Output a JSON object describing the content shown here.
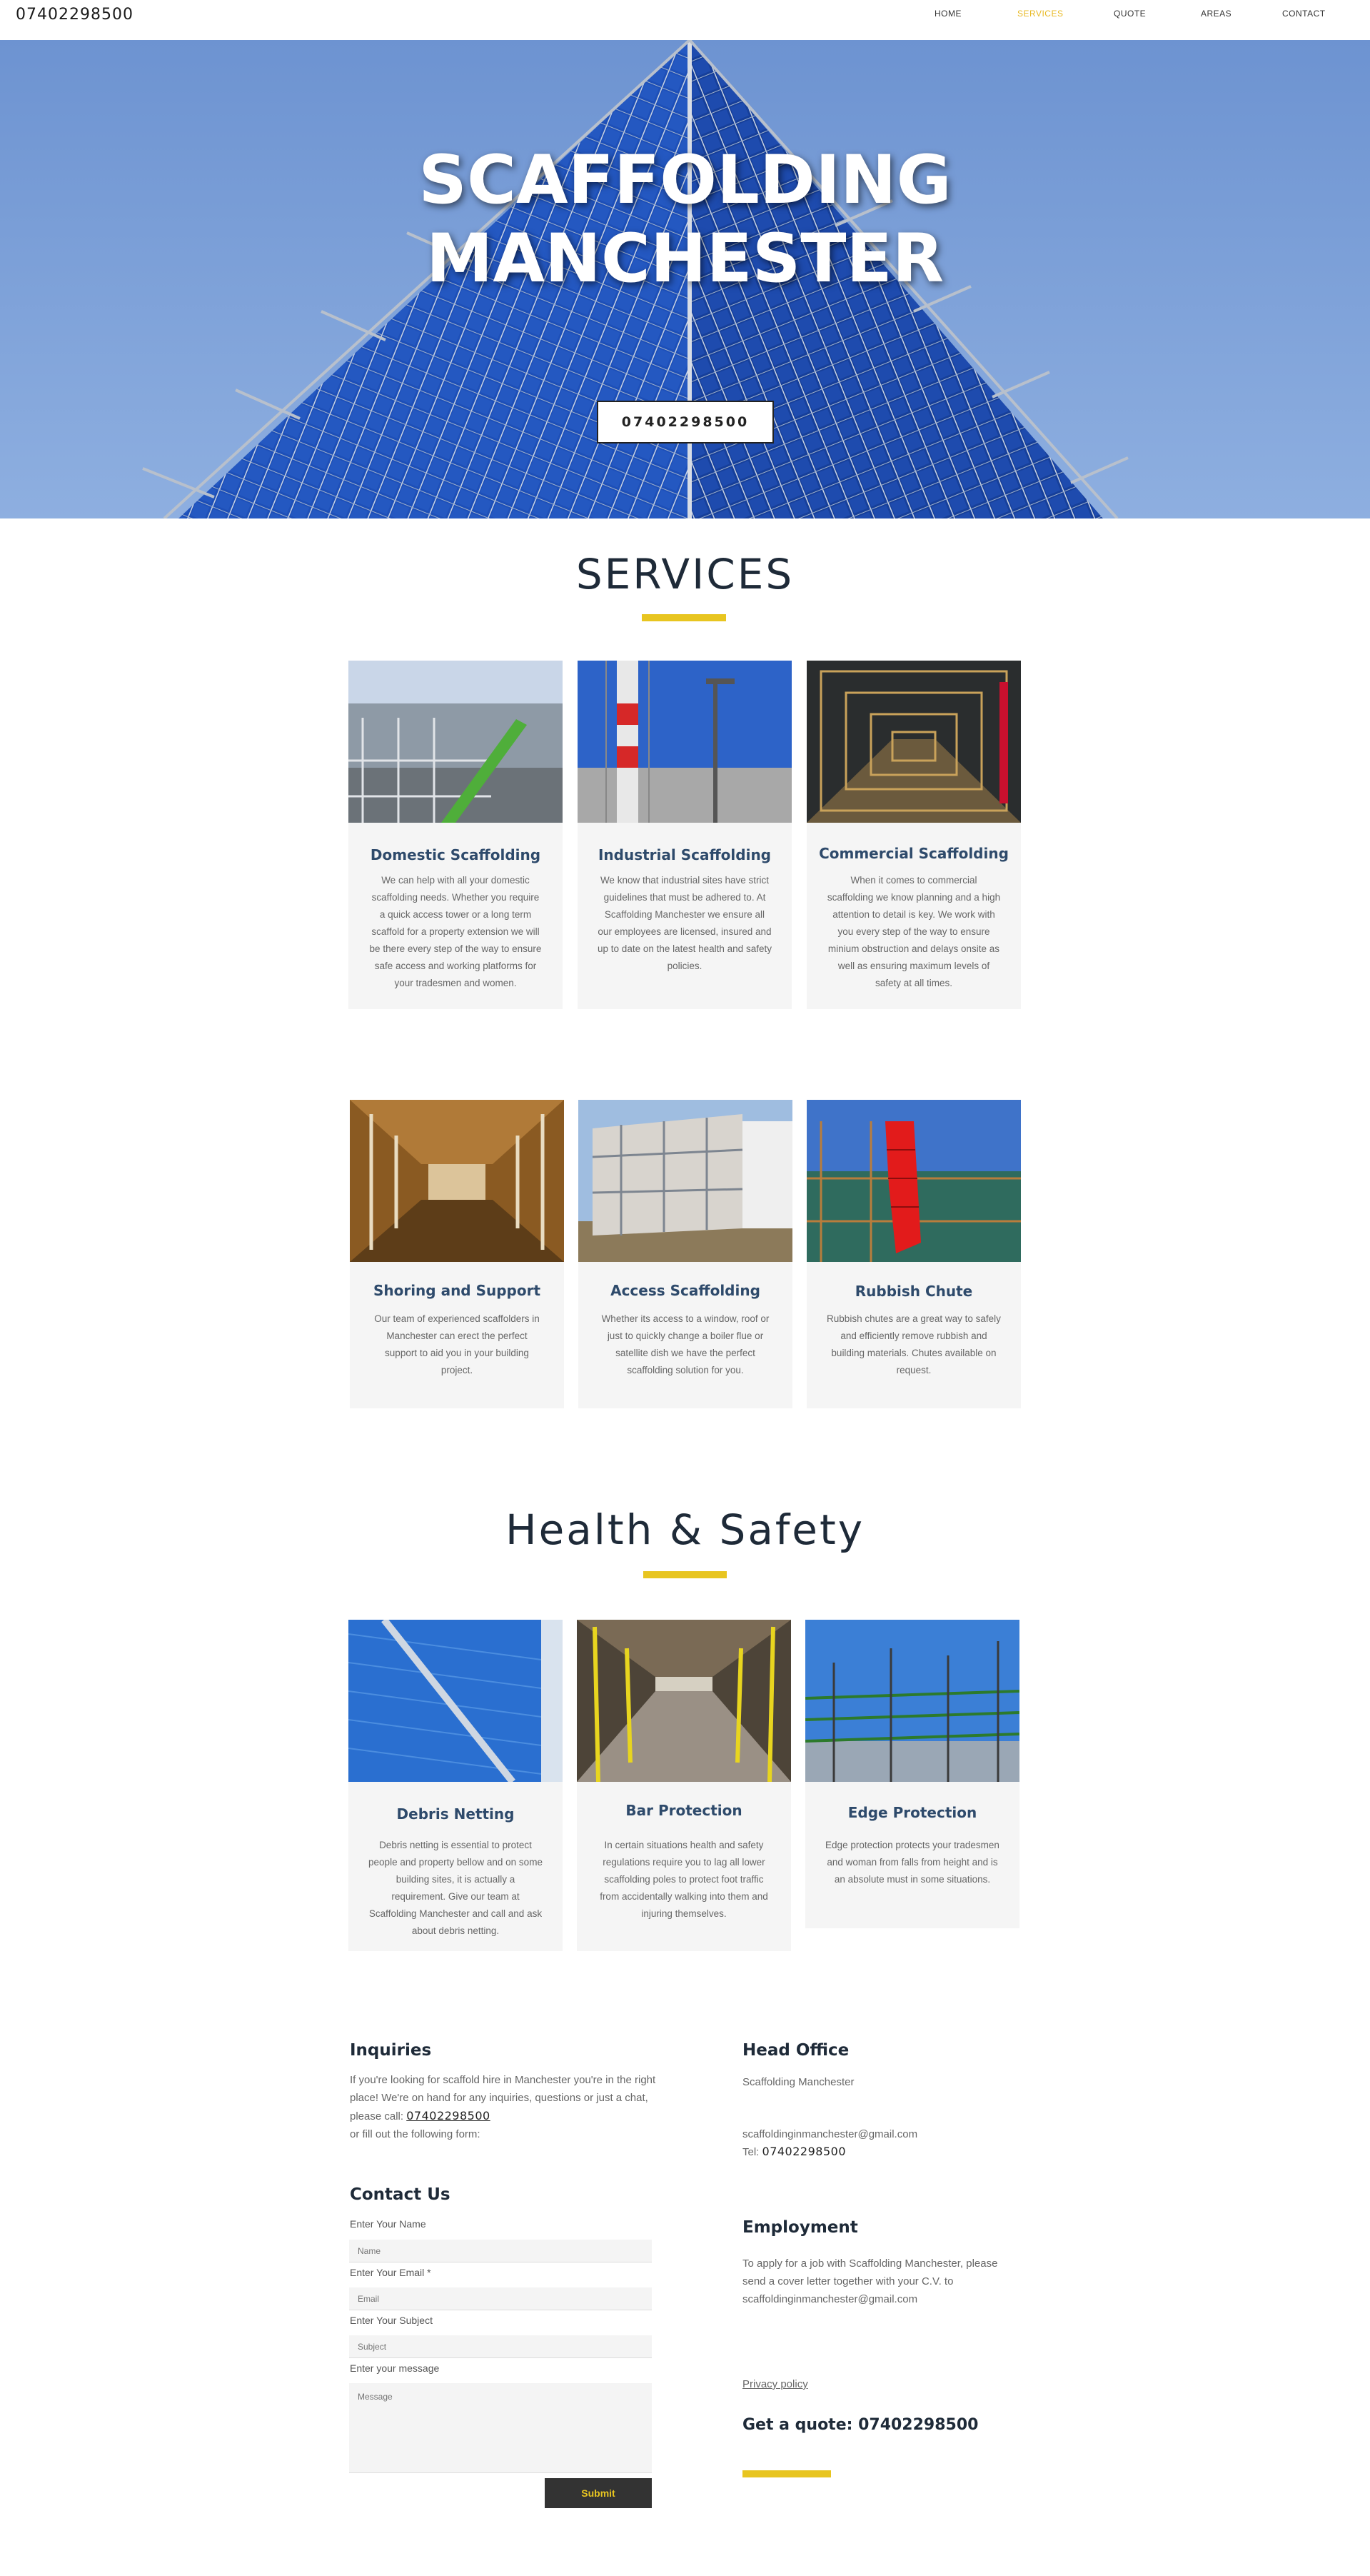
{
  "header": {
    "phone": "07402298500",
    "nav": [
      {
        "label": "HOME"
      },
      {
        "label": "SERVICES",
        "active": true
      },
      {
        "label": "QUOTE"
      },
      {
        "label": "AREAS"
      },
      {
        "label": "CONTACT"
      }
    ]
  },
  "hero": {
    "title_line1": "SCAFFOLDING",
    "title_line2": "MANCHESTER",
    "button_label": "07402298500"
  },
  "services": {
    "title": "SERVICES",
    "cards": [
      {
        "title": "Domestic Scaffolding",
        "text": "We can help with all your domestic scaffolding needs. Whether you require a quick access tower or a long term scaffold for a property extension we will be there every step of the way to ensure safe access and working platforms for your tradesmen and women."
      },
      {
        "title": "Industrial Scaffolding",
        "text": "We know that industrial sites have strict guidelines that must be adhered to. At Scaffolding Manchester we ensure all our employees are licensed, insured and up to date on the latest health and safety policies."
      },
      {
        "title": "Commercial Scaffolding",
        "text": "When it comes to commercial scaffolding we know planning and a high attention to detail is key. We work with you every step of the way to ensure minium obstruction and delays onsite as well as ensuring maximum levels of safety at all times."
      },
      {
        "title": "Shoring and Support",
        "text": "Our team of experienced scaffolders in Manchester can erect the perfect support to aid you in your building project."
      },
      {
        "title": "Access Scaffolding",
        "text": "Whether its access to a window, roof or just to quickly change a boiler flue or satellite dish we have the perfect scaffolding solution for you."
      },
      {
        "title": "Rubbish Chute",
        "text": "Rubbish chutes are a great way to safely and efficiently remove rubbish and building materials. Chutes available on request."
      }
    ]
  },
  "safety": {
    "title": "Health & Safety",
    "cards": [
      {
        "title": "Debris Netting",
        "text": "Debris netting is essential to protect people and property bellow and on some building sites, it is actually a requirement. Give our team at Scaffolding Manchester and call and ask about debris netting."
      },
      {
        "title": "Bar Protection",
        "text": "In certain situations health and safety regulations require you to lag all lower scaffolding poles to protect foot traffic from accidentally walking into them and injuring themselves."
      },
      {
        "title": "Edge Protection",
        "text": "Edge protection protects your tradesmen and woman from falls from height and is an absolute must in some situations."
      }
    ]
  },
  "inquiries": {
    "title": "Inquiries",
    "text_before": "If you're looking for scaffold hire in Manchester you're in the right place! We're on hand for any inquiries, questions or just a chat, please call: ",
    "phone": "07402298500",
    "text_after": "or fill out the following form:"
  },
  "contact_form": {
    "title": "Contact Us",
    "name_label": "Enter Your Name",
    "name_placeholder": "Name",
    "email_label": "Enter Your Email *",
    "email_placeholder": "Email",
    "subject_label": "Enter Your Subject",
    "subject_placeholder": "Subject",
    "message_label": "Enter your message",
    "message_placeholder": "Message",
    "submit_label": "Submit"
  },
  "head_office": {
    "title": "Head Office",
    "name": "Scaffolding Manchester",
    "email": "scaffoldinginmanchester@gmail.com",
    "tel_label": "Tel: ",
    "tel": "07402298500"
  },
  "employment": {
    "title": "Employment",
    "text": "To apply for a job with Scaffolding Manchester, please send a cover letter together with your C.V. to scaffoldinginmanchester@gmail.com"
  },
  "footer": {
    "privacy": "Privacy policy",
    "quote": "Get a quote: 07402298500"
  },
  "colors": {
    "accent": "#e8c520",
    "nav_active": "#e8b923",
    "heading": "#1e2a38",
    "card_title": "#2e4a6b"
  }
}
